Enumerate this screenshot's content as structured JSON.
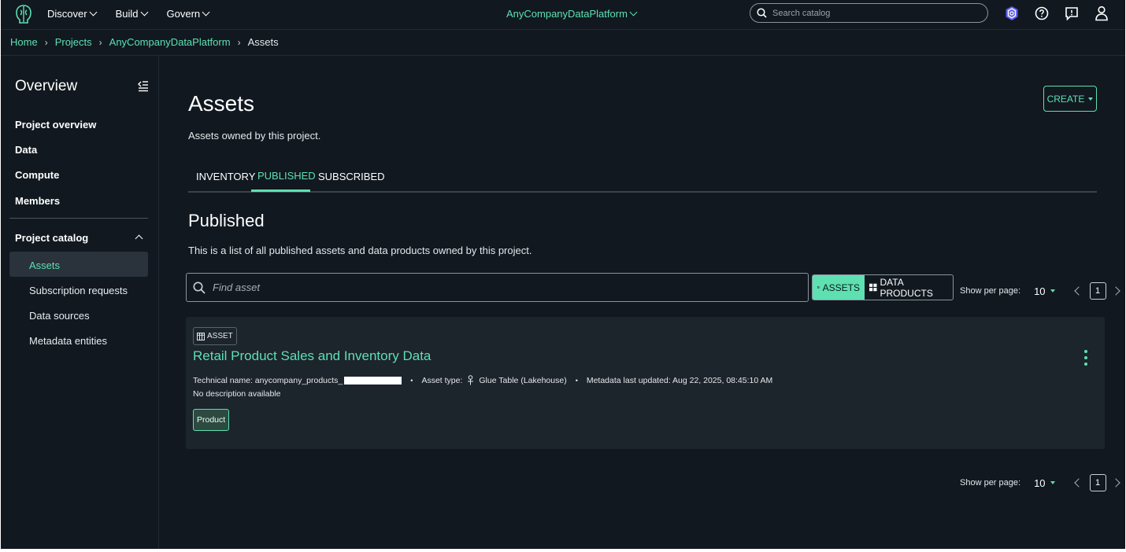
{
  "topbar": {
    "menus": [
      {
        "label": "Discover"
      },
      {
        "label": "Build"
      },
      {
        "label": "Govern"
      }
    ],
    "project": "AnyCompanyDataPlatform",
    "search_placeholder": "Search catalog",
    "icons": [
      "shield-icon",
      "help-icon",
      "feedback-icon",
      "user-icon"
    ]
  },
  "breadcrumb": {
    "items": [
      "Home",
      "Projects",
      "AnyCompanyDataPlatform"
    ],
    "current": "Assets"
  },
  "sidebar": {
    "title": "Overview",
    "links": [
      "Project overview",
      "Data",
      "Compute",
      "Members"
    ],
    "section": "Project catalog",
    "sub_items": [
      "Assets",
      "Subscription requests",
      "Data sources",
      "Metadata entities"
    ],
    "active": "Assets"
  },
  "main": {
    "title": "Assets",
    "subtitle": "Assets owned by this project.",
    "create_label": "CREATE",
    "tabs": [
      "INVENTORY",
      "PUBLISHED",
      "SUBSCRIBED"
    ],
    "active_tab": "PUBLISHED",
    "section_title": "Published",
    "section_subtitle": "This is a list of all published assets and data products owned by this project.",
    "search_placeholder": "Find asset",
    "toggle": {
      "assets": "ASSETS",
      "data_products": "DATA PRODUCTS"
    },
    "pager": {
      "label": "Show per page:",
      "per_page": "10",
      "page": "1"
    }
  },
  "asset": {
    "badge": "ASSET",
    "name": "Retail Product Sales and Inventory Data",
    "technical_name_label": "Technical name: anycompany_products_",
    "asset_type_label": "Asset type:",
    "asset_type": "Glue Table (Lakehouse)",
    "metadata_updated": "Metadata last updated: Aug 22, 2025, 08:45:10 AM",
    "description": "No description available",
    "tag": "Product"
  },
  "colors": {
    "accent": "#5ee0b2",
    "background": "#111820",
    "card": "#1c242c"
  }
}
